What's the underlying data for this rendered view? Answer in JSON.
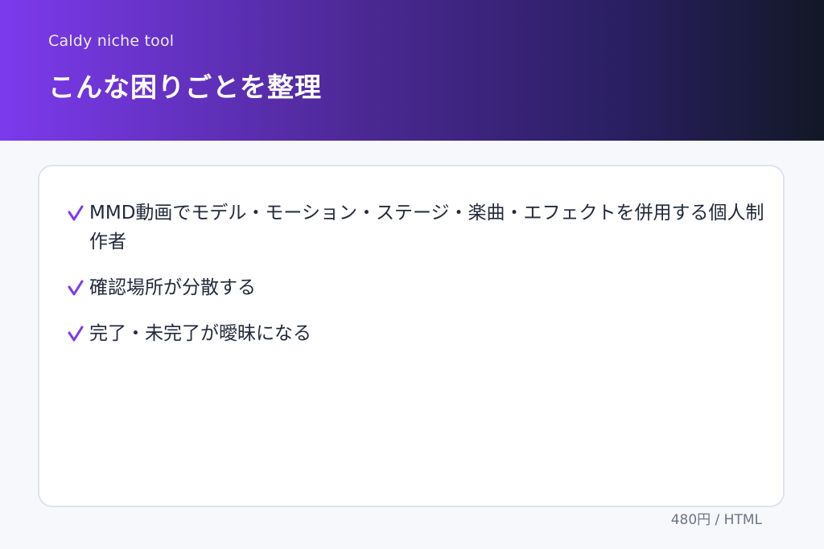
{
  "header": {
    "subtitle": "Caldy niche tool",
    "title": "こんな困りごとを整理"
  },
  "items": [
    "MMD動画でモデル・モーション・ステージ・楽曲・エフェクトを併用する個人制作者",
    "確認場所が分散する",
    "完了・未完了が曖昧になる"
  ],
  "footer": {
    "price": "480円 / HTML"
  },
  "colors": {
    "accent": "#7c3aed",
    "header_start": "#7c3aed",
    "header_end": "#121826"
  },
  "icons": {
    "bullet": "check-icon"
  }
}
